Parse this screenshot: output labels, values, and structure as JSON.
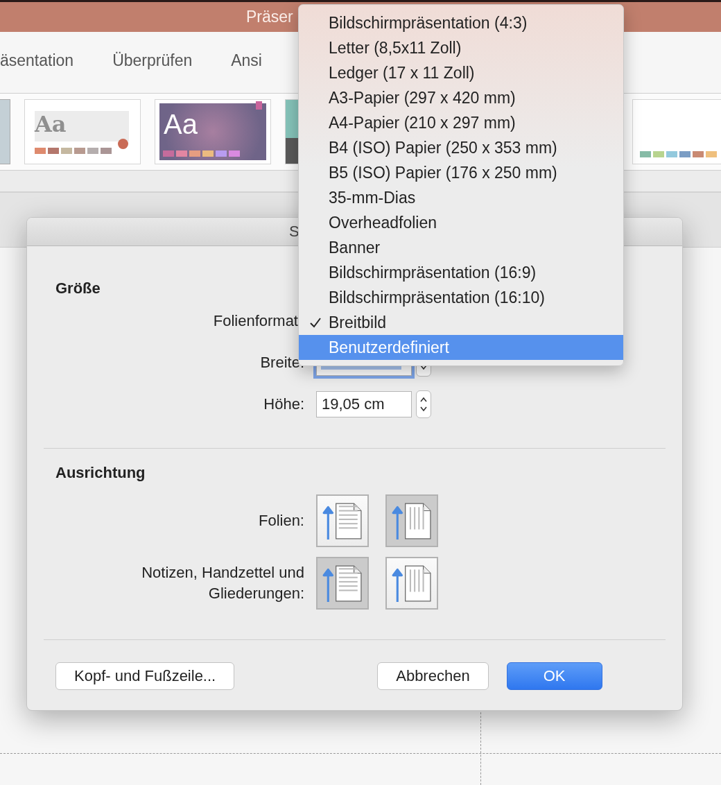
{
  "window": {
    "title": "Präser"
  },
  "ribbon_tabs": [
    {
      "label": "äsentation"
    },
    {
      "label": "Überprüfen"
    },
    {
      "label": "Ansi"
    }
  ],
  "themes": [
    {
      "kind": "partial-grey"
    },
    {
      "kind": "blurred",
      "label": "Aa",
      "swatches": [
        {
          "color": "#de8a6e"
        },
        {
          "color": "#b4776c"
        },
        {
          "color": "#c5b8a0"
        },
        {
          "color": "#b89a90"
        },
        {
          "color": "#b5aeae"
        },
        {
          "color": "#aa9595"
        }
      ]
    },
    {
      "kind": "purple",
      "label": "Aa",
      "swatches": [
        {
          "color": "#c56c9c"
        },
        {
          "color": "#e286a2"
        },
        {
          "color": "#e69d81"
        },
        {
          "color": "#ebbb80"
        },
        {
          "color": "#b89cf0"
        },
        {
          "color": "#d98ae0"
        }
      ]
    },
    {
      "kind": "partial-teal"
    },
    {
      "kind": "white",
      "swatches": [
        {
          "color": "#86bba6"
        },
        {
          "color": "#b8d48f"
        },
        {
          "color": "#93c9dd"
        },
        {
          "color": "#7b9dc4"
        },
        {
          "color": "#c98a73"
        },
        {
          "color": "#efc07e"
        }
      ]
    }
  ],
  "dialog": {
    "title": "S",
    "size": {
      "heading": "Größe",
      "format_label": "Folienformat",
      "width_label": "Breite:",
      "width_field": {
        "focused": true
      },
      "height_label": "Höhe:",
      "height_field": {
        "value": "19,05 cm"
      }
    },
    "orientation": {
      "heading": "Ausrichtung",
      "groups": [
        {
          "label": "Folien:",
          "options": [
            {
              "kind": "portrait",
              "selected": false
            },
            {
              "kind": "landscape",
              "selected": true
            }
          ]
        },
        {
          "label": "Notizen, Handzettel und Gliederungen:",
          "options": [
            {
              "kind": "portrait",
              "selected": true
            },
            {
              "kind": "landscape",
              "selected": false
            }
          ]
        }
      ]
    },
    "buttons": [
      {
        "label": "Kopf- und Fußzeile...",
        "kind": "secondary"
      },
      {
        "label": "Abbrechen",
        "kind": "secondary"
      },
      {
        "label": "OK",
        "kind": "default"
      }
    ]
  },
  "format_menu": {
    "items": [
      {
        "label": "Bildschirmpräsentation (4:3)",
        "checked": false,
        "selected": false
      },
      {
        "label": "Letter (8,5x11 Zoll)",
        "checked": false,
        "selected": false
      },
      {
        "label": "Ledger (17 x 11 Zoll)",
        "checked": false,
        "selected": false
      },
      {
        "label": "A3-Papier (297 x 420 mm)",
        "checked": false,
        "selected": false
      },
      {
        "label": "A4-Papier (210 x 297 mm)",
        "checked": false,
        "selected": false
      },
      {
        "label": "B4 (ISO) Papier (250 x 353 mm)",
        "checked": false,
        "selected": false
      },
      {
        "label": "B5 (ISO) Papier (176 x 250 mm)",
        "checked": false,
        "selected": false
      },
      {
        "label": "35-mm-Dias",
        "checked": false,
        "selected": false
      },
      {
        "label": "Overheadfolien",
        "checked": false,
        "selected": false
      },
      {
        "label": "Banner",
        "checked": false,
        "selected": false
      },
      {
        "label": "Bildschirmpräsentation (16:9)",
        "checked": false,
        "selected": false
      },
      {
        "label": "Bildschirmpräsentation (16:10)",
        "checked": false,
        "selected": false
      },
      {
        "label": "Breitbild",
        "checked": true,
        "selected": false
      },
      {
        "label": "Benutzerdefiniert",
        "checked": false,
        "selected": true
      }
    ]
  }
}
